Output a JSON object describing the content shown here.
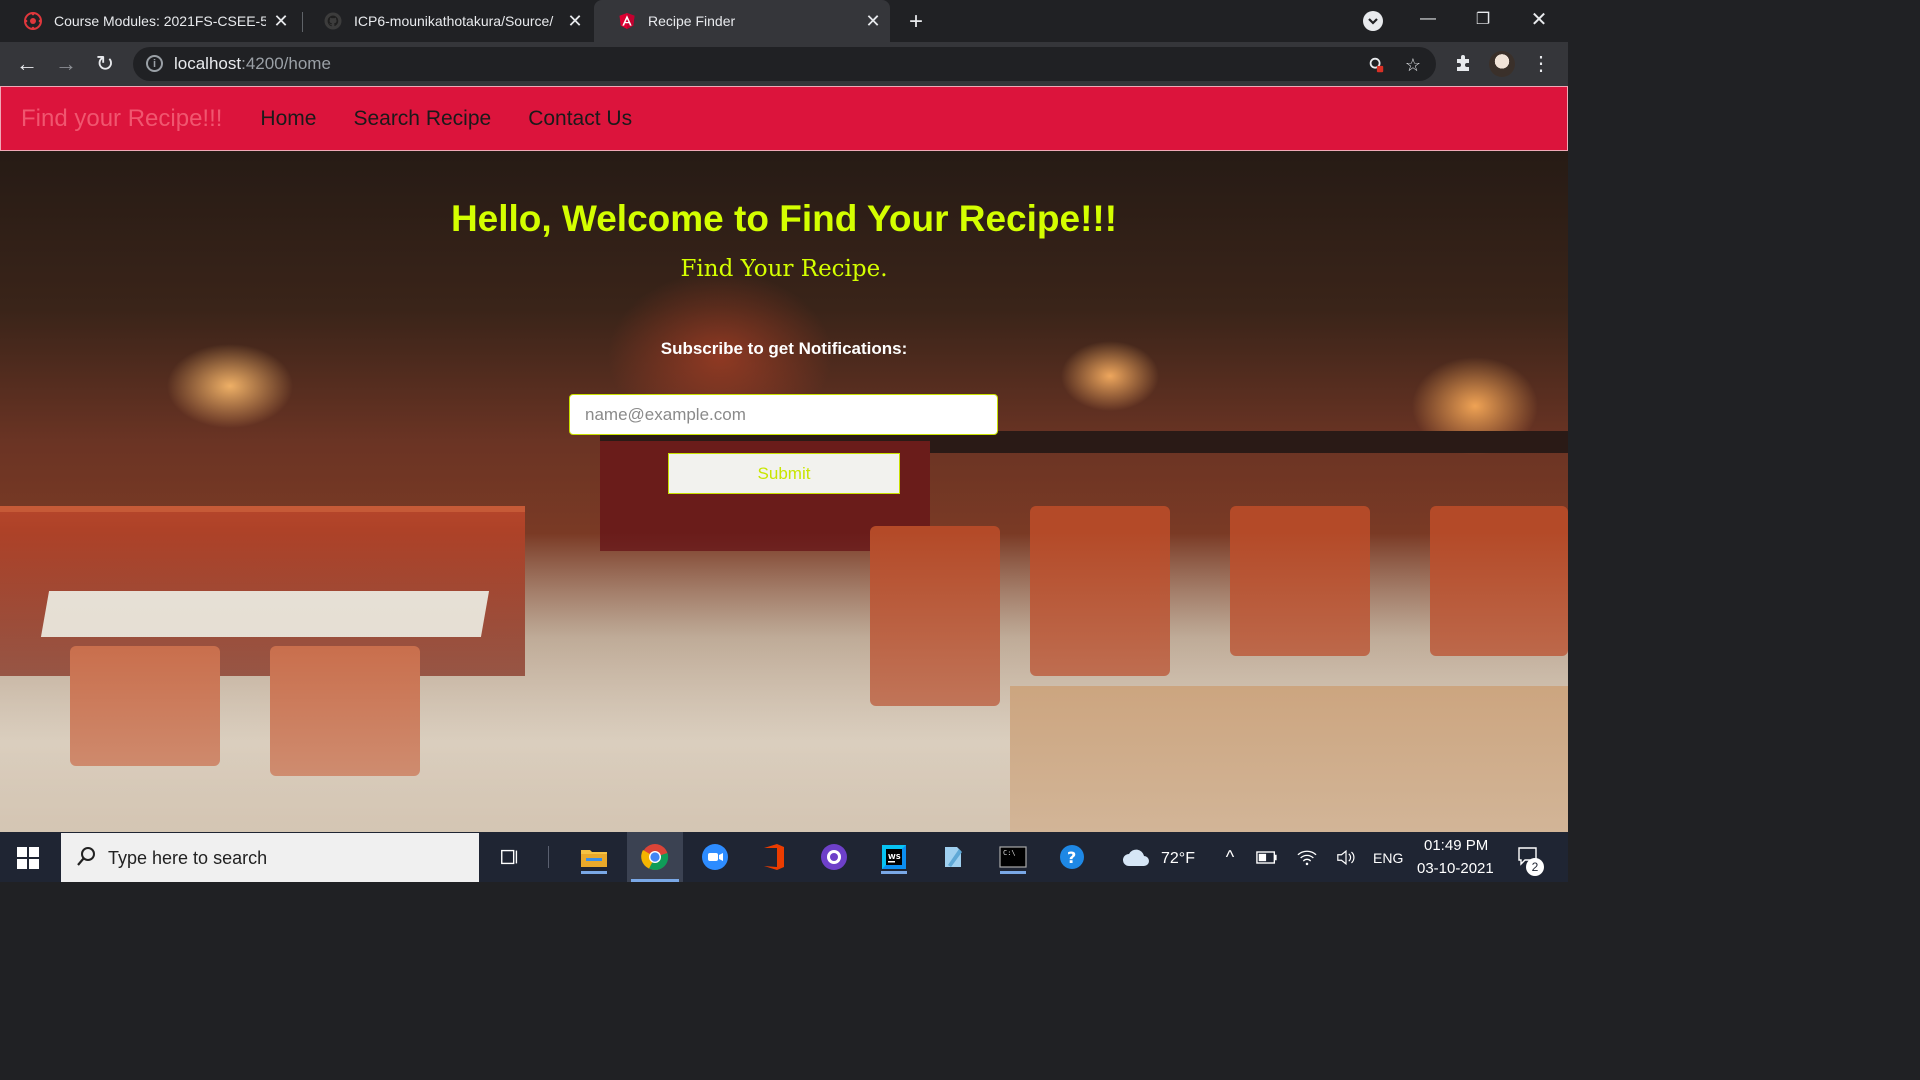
{
  "browser": {
    "tabs": [
      {
        "title": "Course Modules: 2021FS-CSEE-5",
        "icon": "canvas-icon"
      },
      {
        "title": "ICP6-mounikathotakura/Source/",
        "icon": "github-icon"
      },
      {
        "title": "Recipe Finder",
        "icon": "angular-icon",
        "active": true
      }
    ],
    "url_host": "localhost",
    "url_path": ":4200/home"
  },
  "page": {
    "brand": "Find your Recipe!!!",
    "nav": [
      "Home",
      "Search Recipe",
      "Contact Us"
    ],
    "hero_prefix": "Hello, Welcome to ",
    "hero_strong": "Find Your Recipe!!!",
    "hero_sub": "Find Your Recipe.",
    "subscribe_label": "Subscribe to get Notifications:",
    "email_placeholder": "name@example.com",
    "submit_label": "Submit"
  },
  "taskbar": {
    "search_placeholder": "Type here to search",
    "weather": "72°F",
    "language": "ENG",
    "time": "01:49 PM",
    "date": "03-10-2021",
    "notification_count": "2"
  },
  "colors": {
    "navbar": "#dc143c",
    "accent": "#d4ff00"
  }
}
